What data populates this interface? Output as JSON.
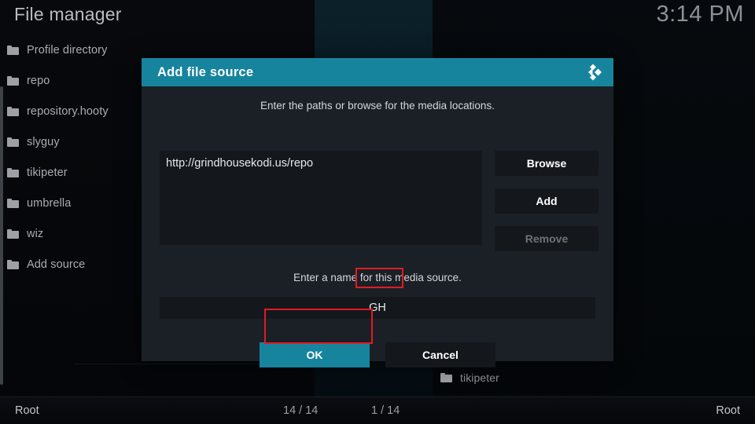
{
  "app": {
    "title": "File manager",
    "clock": "3:14 PM"
  },
  "colors": {
    "accent": "#17849e",
    "dialog_bg": "#1b2026",
    "field_bg": "#14181d",
    "annotation": "#e01b24",
    "text_primary": "#e6e9ec",
    "text_muted": "#9a9ea3"
  },
  "left_panel": {
    "items": [
      {
        "label": "Profile directory",
        "icon": "folder-icon"
      },
      {
        "label": "repo",
        "icon": "folder-icon"
      },
      {
        "label": "repository.hooty",
        "icon": "folder-icon"
      },
      {
        "label": "slyguy",
        "icon": "folder-icon"
      },
      {
        "label": "tikipeter",
        "icon": "folder-icon"
      },
      {
        "label": "umbrella",
        "icon": "folder-icon"
      },
      {
        "label": "wiz",
        "icon": "folder-icon"
      },
      {
        "label": "Add source",
        "icon": "folder-icon"
      }
    ]
  },
  "right_panel": {
    "items": [
      {
        "label": "tikipeter",
        "icon": "folder-icon"
      }
    ]
  },
  "statusbar": {
    "left_path": "Root",
    "left_count": "14 / 14",
    "right_count": "1 / 14",
    "right_path": "Root"
  },
  "dialog": {
    "title": "Add file source",
    "logo_icon": "kodi-logo-icon",
    "paths_hint": "Enter the paths or browse for the media locations.",
    "paths": [
      "http://grindhousekodi.us/repo"
    ],
    "side_buttons": [
      {
        "label": "Browse",
        "disabled": false
      },
      {
        "label": "Add",
        "disabled": false
      },
      {
        "label": "Remove",
        "disabled": true
      }
    ],
    "name_hint": "Enter a name for this media source.",
    "name_value": "GH",
    "footer_buttons": [
      {
        "label": "OK",
        "focused": true
      },
      {
        "label": "Cancel",
        "focused": false
      }
    ]
  }
}
